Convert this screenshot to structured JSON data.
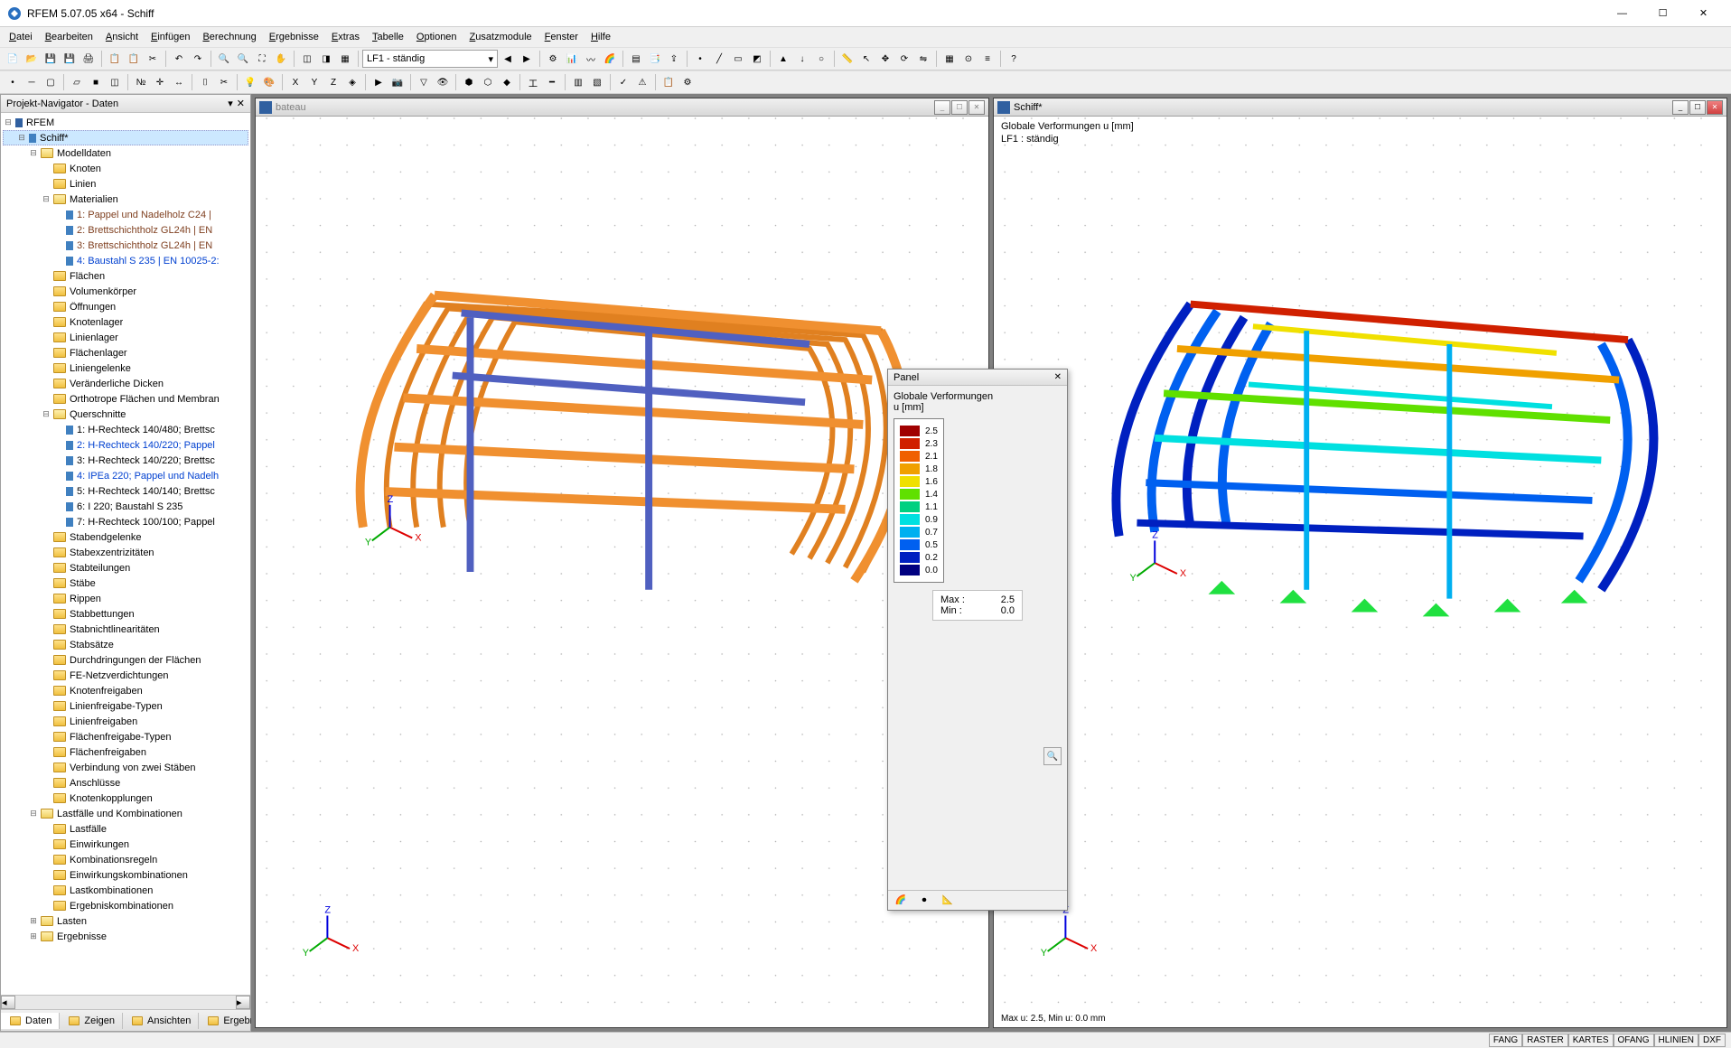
{
  "app": {
    "title": "RFEM 5.07.05 x64 - Schiff",
    "win_min": "—",
    "win_max": "☐",
    "win_close": "✕"
  },
  "menu": [
    "Datei",
    "Bearbeiten",
    "Ansicht",
    "Einfügen",
    "Berechnung",
    "Ergebnisse",
    "Extras",
    "Tabelle",
    "Optionen",
    "Zusatzmodule",
    "Fenster",
    "Hilfe"
  ],
  "combo_loadcase": "LF1 - ständig",
  "navigator": {
    "title": "Projekt-Navigator - Daten",
    "root": "RFEM",
    "project": "Schiff*",
    "groups": [
      {
        "label": "Modelldaten",
        "open": true,
        "children": [
          {
            "label": "Knoten"
          },
          {
            "label": "Linien"
          },
          {
            "label": "Materialien",
            "open": true,
            "items": [
              {
                "label": "1: Pappel und Nadelholz C24 |",
                "cls": "brown"
              },
              {
                "label": "2: Brettschichtholz GL24h | EN",
                "cls": "brown"
              },
              {
                "label": "3: Brettschichtholz GL24h | EN",
                "cls": "brown"
              },
              {
                "label": "4: Baustahl S 235 | EN 10025-2:",
                "cls": "blue"
              }
            ]
          },
          {
            "label": "Flächen"
          },
          {
            "label": "Volumenkörper"
          },
          {
            "label": "Öffnungen"
          },
          {
            "label": "Knotenlager"
          },
          {
            "label": "Linienlager"
          },
          {
            "label": "Flächenlager"
          },
          {
            "label": "Liniengelenke"
          },
          {
            "label": "Veränderliche Dicken"
          },
          {
            "label": "Orthotrope Flächen und Membran"
          },
          {
            "label": "Querschnitte",
            "open": true,
            "items": [
              {
                "label": "1: H-Rechteck 140/480; Brettsc"
              },
              {
                "label": "2: H-Rechteck 140/220; Pappel",
                "cls": "blue"
              },
              {
                "label": "3: H-Rechteck 140/220; Brettsc"
              },
              {
                "label": "4: IPEa 220; Pappel und Nadelh",
                "cls": "blue"
              },
              {
                "label": "5: H-Rechteck 140/140; Brettsc"
              },
              {
                "label": "6: I 220; Baustahl S 235"
              },
              {
                "label": "7: H-Rechteck 100/100; Pappel"
              }
            ]
          },
          {
            "label": "Stabendgelenke"
          },
          {
            "label": "Stabexzentrizitäten"
          },
          {
            "label": "Stabteilungen"
          },
          {
            "label": "Stäbe"
          },
          {
            "label": "Rippen"
          },
          {
            "label": "Stabbettungen"
          },
          {
            "label": "Stabnichtlinearitäten"
          },
          {
            "label": "Stabsätze"
          },
          {
            "label": "Durchdringungen der Flächen"
          },
          {
            "label": "FE-Netzverdichtungen"
          },
          {
            "label": "Knotenfreigaben"
          },
          {
            "label": "Linienfreigabe-Typen"
          },
          {
            "label": "Linienfreigaben"
          },
          {
            "label": "Flächenfreigabe-Typen"
          },
          {
            "label": "Flächenfreigaben"
          },
          {
            "label": "Verbindung von zwei Stäben"
          },
          {
            "label": "Anschlüsse"
          },
          {
            "label": "Knotenkopplungen"
          }
        ]
      },
      {
        "label": "Lastfälle und Kombinationen",
        "open": true,
        "children": [
          {
            "label": "Lastfälle"
          },
          {
            "label": "Einwirkungen"
          },
          {
            "label": "Kombinationsregeln"
          },
          {
            "label": "Einwirkungskombinationen"
          },
          {
            "label": "Lastkombinationen"
          },
          {
            "label": "Ergebniskombinationen"
          }
        ]
      },
      {
        "label": "Lasten"
      },
      {
        "label": "Ergebnisse"
      }
    ],
    "tabs": [
      "Daten",
      "Zeigen",
      "Ansichten",
      "Ergebnis..."
    ]
  },
  "docs": {
    "left": {
      "title": "bateau"
    },
    "right": {
      "title": "Schiff*",
      "info_line1": "Globale Verformungen u [mm]",
      "info_line2": "LF1 : ständig",
      "footer": "Max u: 2.5, Min u: 0.0 mm"
    }
  },
  "panel": {
    "title": "Panel",
    "heading": "Globale Verformungen",
    "unit": "u [mm]",
    "legend": [
      {
        "c": "#a00000",
        "v": "2.5"
      },
      {
        "c": "#d02000",
        "v": "2.3"
      },
      {
        "c": "#f06000",
        "v": "2.1"
      },
      {
        "c": "#f0a000",
        "v": "1.8"
      },
      {
        "c": "#f0e000",
        "v": "1.6"
      },
      {
        "c": "#60e000",
        "v": "1.4"
      },
      {
        "c": "#00d080",
        "v": "1.1"
      },
      {
        "c": "#00e0e0",
        "v": "0.9"
      },
      {
        "c": "#00b0f0",
        "v": "0.7"
      },
      {
        "c": "#0060f0",
        "v": "0.5"
      },
      {
        "c": "#0020c0",
        "v": "0.2"
      },
      {
        "c": "#000080",
        "v": "0.0"
      }
    ],
    "max_label": "Max  :",
    "max_val": "2.5",
    "min_label": "Min   :",
    "min_val": "0.0"
  },
  "status": [
    "FANG",
    "RASTER",
    "KARTES",
    "OFANG",
    "HLINIEN",
    "DXF"
  ],
  "chart_data": {
    "type": "table",
    "title": "Globale Verformungen u [mm] — color legend",
    "series": [
      {
        "name": "u [mm]",
        "values": [
          2.5,
          2.3,
          2.1,
          1.8,
          1.6,
          1.4,
          1.1,
          0.9,
          0.7,
          0.5,
          0.2,
          0.0
        ]
      }
    ],
    "summary": {
      "max": 2.5,
      "min": 0.0
    }
  }
}
